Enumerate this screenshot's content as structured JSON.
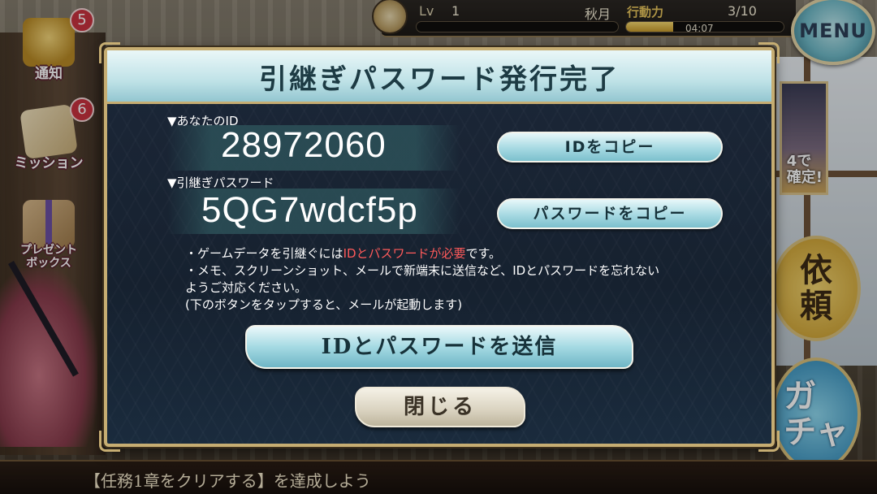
{
  "status_bar": {
    "level_label": "Lv",
    "level_value": "1",
    "player_name": "秋月",
    "stamina_label": "行動力",
    "stamina_value": "3/10",
    "stamina_fraction": 0.3,
    "stamina_timer": "04:07"
  },
  "menu": {
    "label": "MENU"
  },
  "side_icons": {
    "notice": {
      "label": "通知",
      "badge": "5",
      "icon": "bell-icon"
    },
    "mission": {
      "label": "ミッション",
      "badge": "6",
      "icon": "scroll-icon"
    },
    "present": {
      "label": "プレゼント\nボックス",
      "icon": "gift-icon"
    }
  },
  "right_side": {
    "banner_text": "4で\n確定!",
    "request_label": "依\n頼",
    "gacha_label": "ガ\nチャ"
  },
  "modal": {
    "title": "引継ぎパスワード発行完了",
    "id_label": "▼あなたのID",
    "id_value": "28972060",
    "copy_id_button": "IDをコピー",
    "password_label": "▼引継ぎパスワード",
    "password_value": "5QG7wdcf5p",
    "copy_password_button": "パスワードをコピー",
    "notes": {
      "line1_prefix": "・ゲームデータを引継ぐには",
      "line1_highlight": "IDとパスワードが必要",
      "line1_suffix": "です。",
      "line2": "・メモ、スクリーンショット、メールで新端末に送信など、IDとパスワードを忘れない",
      "line3": "ようご対応ください。",
      "line4": "(下のボタンをタップすると、メールが起動します)"
    },
    "send_button": "IDとパスワードを送信",
    "close_button": "閉じる"
  },
  "bottom_ticker": {
    "text": "【任務1章をクリアする】を達成しよう"
  },
  "colors": {
    "accent_gold": "#c6ad72",
    "button_cyan": "#a6d9e2",
    "modal_bg": "#1c2738",
    "warning_red": "#ff5a5a",
    "badge_red": "#c8323f"
  }
}
